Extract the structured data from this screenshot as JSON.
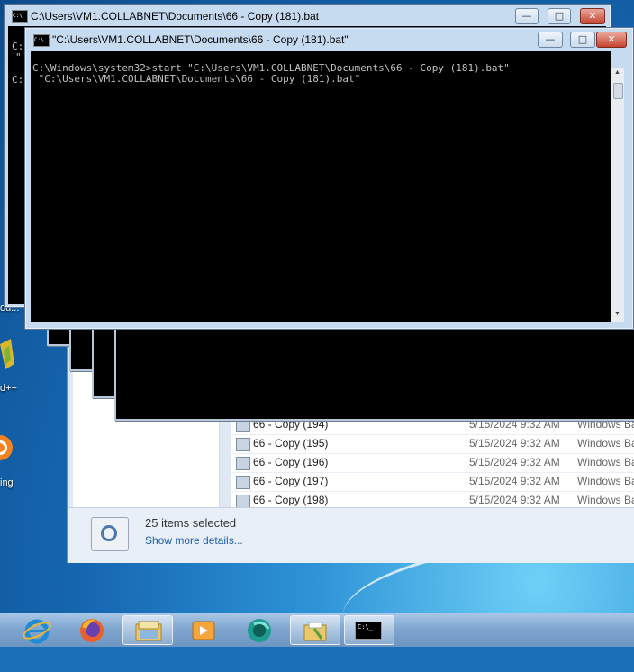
{
  "desktop": {
    "icon_labels": [
      "ou...",
      "d++",
      "ing"
    ]
  },
  "explorer": {
    "files": [
      {
        "name": "66 - Copy (194)",
        "date": "5/15/2024 9:32 AM",
        "type": "Windows Ba"
      },
      {
        "name": "66 - Copy (195)",
        "date": "5/15/2024 9:32 AM",
        "type": "Windows Ba"
      },
      {
        "name": "66 - Copy (196)",
        "date": "5/15/2024 9:32 AM",
        "type": "Windows Ba"
      },
      {
        "name": "66 - Copy (197)",
        "date": "5/15/2024 9:32 AM",
        "type": "Windows Ba"
      },
      {
        "name": "66 - Copy (198)",
        "date": "5/15/2024 9:32 AM",
        "type": "Windows Ba"
      }
    ],
    "selection_text": "25 items selected",
    "show_more": "Show more details..."
  },
  "back_window": {
    "title": "C:\\Users\\VM1.COLLABNET\\Documents\\66 - Copy (181).bat",
    "console_lines": [
      "C:",
      "\"",
      "C:"
    ]
  },
  "front_window": {
    "title": "\"C:\\Users\\VM1.COLLABNET\\Documents\\66 - Copy (181).bat\"",
    "console_lines": [
      "C:\\Windows\\system32>start \"C:\\Users\\VM1.COLLABNET\\Documents\\66 - Copy (181).bat\"",
      " \"C:\\Users\\VM1.COLLABNET\\Documents\\66 - Copy (181).bat\""
    ]
  },
  "controls": {
    "minimize": "—",
    "maximize": "□",
    "close": "✕"
  },
  "title_icon_text": "C:\\",
  "taskbar": {
    "items": [
      "internet-explorer-icon",
      "firefox-icon",
      "file-explorer-icon",
      "media-player-icon",
      "app-icon",
      "folder-icon",
      "command-prompt-icon"
    ],
    "cmd_label": "C:\\_"
  },
  "colors": {
    "console_bg": "#000000",
    "console_text": "#c0c0c0",
    "title_bar": "#c6dbf0",
    "close_button": "#c7432f",
    "link": "#1e5fa8"
  }
}
